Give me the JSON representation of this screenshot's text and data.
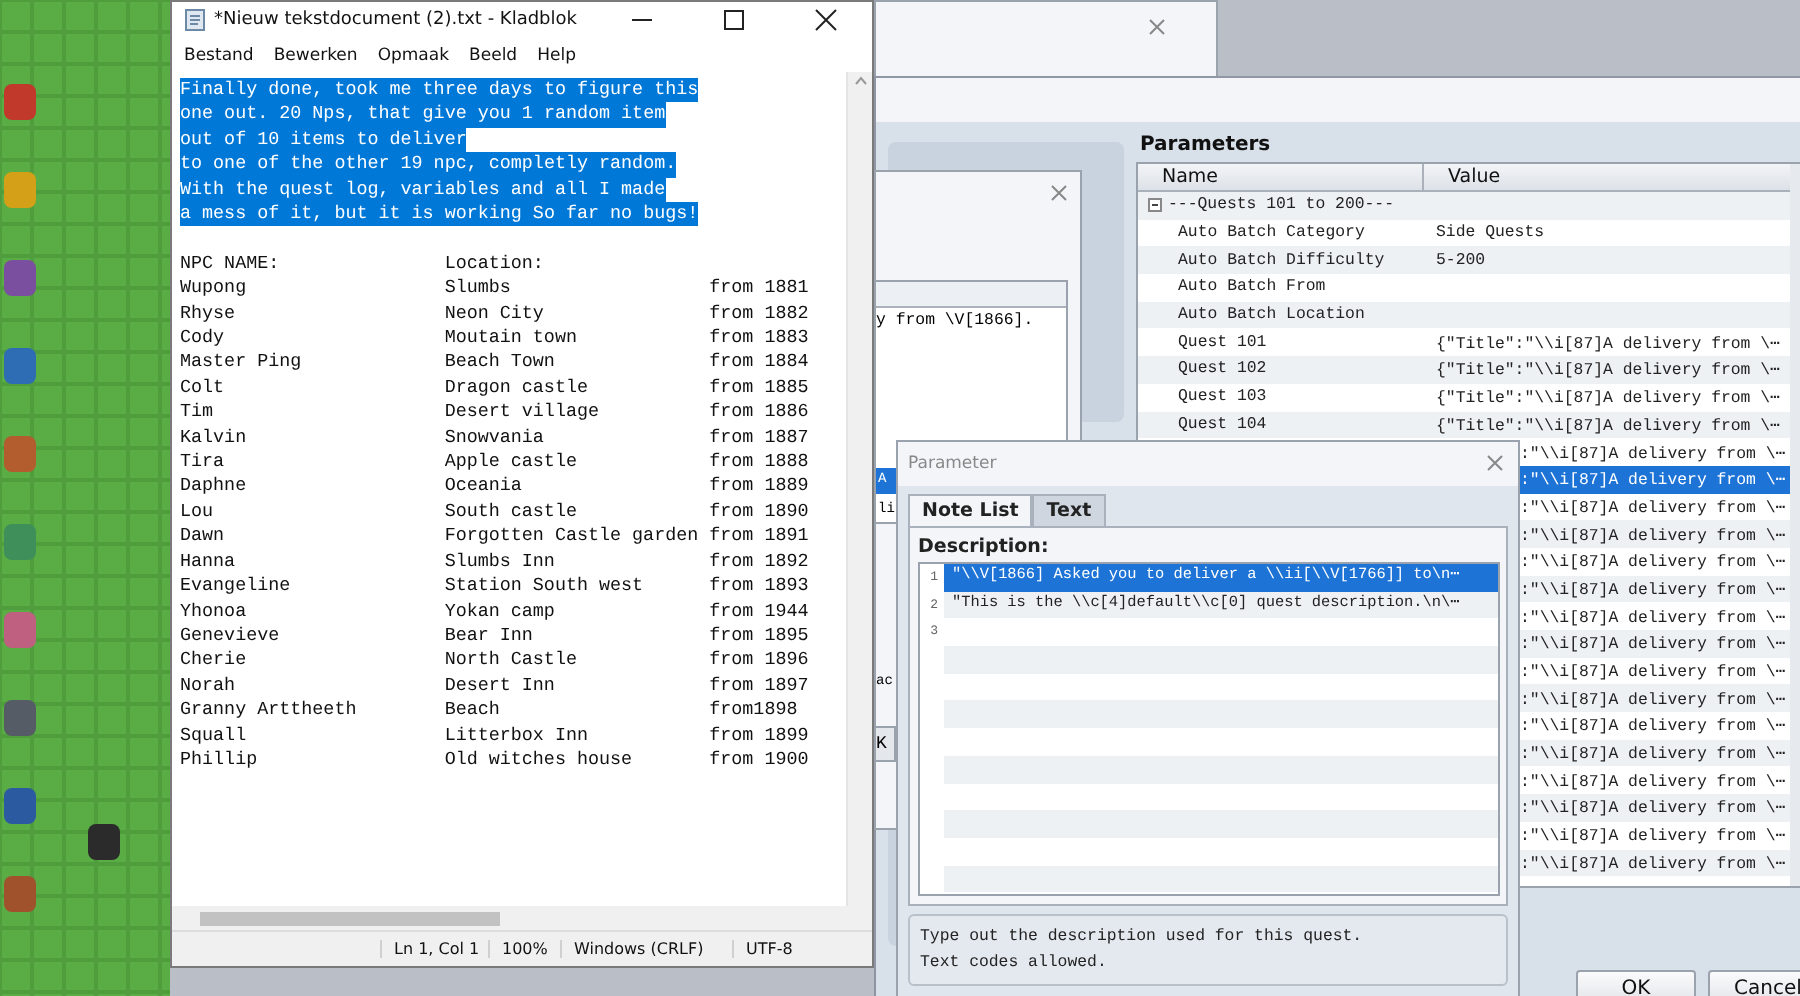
{
  "notepad": {
    "title": "*Nieuw tekstdocument (2).txt - Kladblok",
    "menu": [
      "Bestand",
      "Bewerken",
      "Opmaak",
      "Beeld",
      "Help"
    ],
    "selected_lines": [
      "Finally done, took me three days to figure this",
      "one out. 20 Nps, that give you 1 random item",
      "out of 10 items to deliver",
      "to one of the other 19 npc, completly random.",
      "With the quest log, variables and all I made",
      "a mess of it, but it is working So far no bugs!"
    ],
    "header": {
      "name": "NPC NAME:",
      "location": "Location:"
    },
    "npcs": [
      {
        "name": "Wupong",
        "location": "Slumbs",
        "from": "from 1881"
      },
      {
        "name": "Rhyse",
        "location": "Neon City",
        "from": "from 1882"
      },
      {
        "name": "Cody",
        "location": "Moutain town",
        "from": "from 1883"
      },
      {
        "name": "Master Ping",
        "location": "Beach Town",
        "from": "from 1884"
      },
      {
        "name": "Colt",
        "location": "Dragon castle",
        "from": "from 1885"
      },
      {
        "name": "Tim",
        "location": "Desert village",
        "from": "from 1886"
      },
      {
        "name": "Kalvin",
        "location": "Snowvania",
        "from": "from 1887"
      },
      {
        "name": "Tira",
        "location": "Apple castle",
        "from": "from 1888"
      },
      {
        "name": "Daphne",
        "location": "Oceania",
        "from": "from 1889"
      },
      {
        "name": "Lou",
        "location": "South castle",
        "from": "from 1890"
      },
      {
        "name": "Dawn",
        "location": "Forgotten Castle garden",
        "from": "from 1891"
      },
      {
        "name": "Hanna",
        "location": "Slumbs Inn",
        "from": "from 1892"
      },
      {
        "name": "Evangeline",
        "location": "Station South west",
        "from": "from 1893"
      },
      {
        "name": "Yhonoa",
        "location": "Yokan camp",
        "from": "from 1944"
      },
      {
        "name": "Genevieve",
        "location": "Bear Inn",
        "from": "from 1895"
      },
      {
        "name": "Cherie",
        "location": "North Castle",
        "from": "from 1896"
      },
      {
        "name": "Norah",
        "location": "Desert Inn",
        "from": "from 1897"
      },
      {
        "name": "Granny Arttheeth",
        "location": "Beach",
        "from": "from1898"
      },
      {
        "name": "Squall",
        "location": "Litterbox Inn",
        "from": "from 1899"
      },
      {
        "name": "Phillip",
        "location": "Old witches house",
        "from": "from 1900"
      }
    ],
    "status_bar": [
      "Ln 1, Col 1",
      "100%",
      "Windows (CRLF)",
      "UTF-8"
    ]
  },
  "small_dialog": {
    "row": "y from \\V[1866].",
    "list_rows": [
      {
        "text": "A",
        "selected": true
      },
      {
        "text": "li",
        "selected": false
      }
    ],
    "label": "ac",
    "button": "K"
  },
  "plugin_manager": {
    "parameters_title": "Parameters",
    "columns": [
      "Name",
      "Value"
    ],
    "group": {
      "label": "---Quests 101 to 200---",
      "expanded": true
    },
    "rows": [
      {
        "name": "Auto Batch Category",
        "value": "Side Quests",
        "selected": false
      },
      {
        "name": "Auto Batch Difficulty",
        "value": "5-200",
        "selected": false
      },
      {
        "name": "Auto Batch From",
        "selected": false
      },
      {
        "name": "Auto Batch Location",
        "selected": false
      },
      {
        "name": "Quest 101",
        "value": "{\"Title\":\"\\\\i[87]A delivery from \\⋯",
        "selected": false
      },
      {
        "name": "Quest 102",
        "value": "{\"Title\":\"\\\\i[87]A delivery from \\⋯",
        "selected": false
      },
      {
        "name": "Quest 103",
        "value": "{\"Title\":\"\\\\i[87]A delivery from \\⋯",
        "selected": false
      },
      {
        "name": "Quest 104",
        "value": "{\"Title\":\"\\\\i[87]A delivery from \\⋯",
        "selected": false
      },
      {
        "value": ":\"\\\\i[87]A delivery from \\⋯",
        "selected": false
      },
      {
        "value": ":\"\\\\i[87]A delivery from \\⋯",
        "selected": true
      },
      {
        "value": ":\"\\\\i[87]A delivery from \\⋯",
        "selected": false
      },
      {
        "value": ":\"\\\\i[87]A delivery from \\⋯",
        "selected": false
      },
      {
        "value": ":\"\\\\i[87]A delivery from \\⋯",
        "selected": false
      },
      {
        "value": ":\"\\\\i[87]A delivery from \\⋯",
        "selected": false
      },
      {
        "value": ":\"\\\\i[87]A delivery from \\⋯",
        "selected": false
      },
      {
        "value": ":\"\\\\i[87]A delivery from \\⋯",
        "selected": false
      },
      {
        "value": ":\"\\\\i[87]A delivery from \\⋯",
        "selected": false
      },
      {
        "value": ":\"\\\\i[87]A delivery from \\⋯",
        "selected": false
      },
      {
        "value": ":\"\\\\i[87]A delivery from \\⋯",
        "selected": false
      },
      {
        "value": ":\"\\\\i[87]A delivery from \\⋯",
        "selected": false
      },
      {
        "value": ":\"\\\\i[87]A delivery from \\⋯",
        "selected": false
      },
      {
        "value": ":\"\\\\i[87]A delivery from \\⋯",
        "selected": false
      },
      {
        "value": ":\"\\\\i[87]A delivery from \\⋯",
        "selected": false
      },
      {
        "value": ":\"\\\\i[87]A delivery from \\⋯",
        "selected": false
      }
    ],
    "buttons": [
      "OK",
      "Cancel"
    ]
  },
  "parameter_dialog": {
    "title": "Parameter",
    "tabs": [
      {
        "label": "Note List",
        "selected": true
      },
      {
        "label": "Text",
        "selected": false
      }
    ],
    "label": "Description:",
    "lines": [
      {
        "number": "1",
        "text": "\"\\\\V[1866] Asked you to deliver a \\\\ii[\\\\V[1766]] to\\n⋯",
        "selected": true
      },
      {
        "number": "2",
        "text": "\"This is the \\\\c[4]default\\\\c[0] quest description.\\n\\⋯",
        "selected": false
      },
      {
        "number": "3",
        "selected": false
      }
    ],
    "help": [
      "Type out the description used for this quest.",
      "Text codes allowed."
    ]
  }
}
